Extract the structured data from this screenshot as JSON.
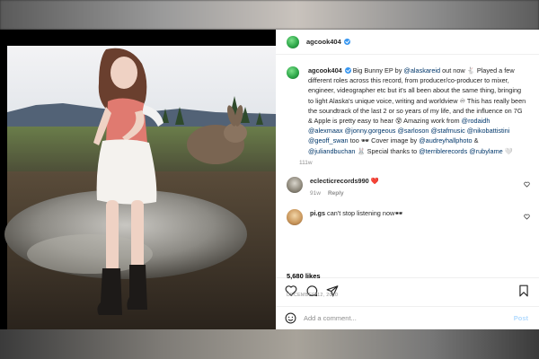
{
  "post": {
    "author": "agcook404",
    "verified_icon": "verified-badge-icon",
    "caption_parts": {
      "p1": " Big Bunny EP by ",
      "m1": "@alaskareid",
      "p2": " out now 🐇 Played a few different roles across this record, from producer/co-producer to mixer, engineer, videographer etc but it's all been about the same thing, bringing to light Alaska's unique voice, writing and worldview ♾ This has really been the soundtrack of the last 2 or so years of my life, and the influence on 7G & Apple is pretty easy to hear 😵 Amazing work from ",
      "m2": "@rodaidh",
      "m3": "@alexmaax",
      "m4": "@jonny.gorgeous",
      "m5": "@sarloson",
      "m6": "@stafmusic",
      "m7": "@nikobattistini",
      "m8": "@geoff_swan",
      "p3": " too 🕶 Cover image by ",
      "m9": "@audreyhallphoto",
      "p4": " & ",
      "m10": "@juliandbuchan",
      "p5": " 🐰 Special thanks to ",
      "m11": "@terriblerecords",
      "m12": "@rubylame",
      "p6": " 🤍"
    },
    "caption_age": "111w",
    "likes": "5,680 likes",
    "date": "DECEMBER 12, 2020"
  },
  "comments": [
    {
      "user": "eclecticrecords990",
      "text": " ❤️",
      "age": "91w",
      "reply": "Reply"
    },
    {
      "user": "pi.gs",
      "text": " can't stop listening now🕶",
      "age": "",
      "reply": ""
    }
  ],
  "composer": {
    "placeholder": "Add a comment...",
    "post_label": "Post"
  },
  "colors": {
    "link": "#00376b",
    "verified": "#3897f0",
    "post_button_disabled": "#b3dbff"
  },
  "icons": [
    "heart-icon",
    "comment-icon",
    "share-icon",
    "save-bookmark-icon",
    "emoji-icon",
    "small-heart-icon"
  ]
}
